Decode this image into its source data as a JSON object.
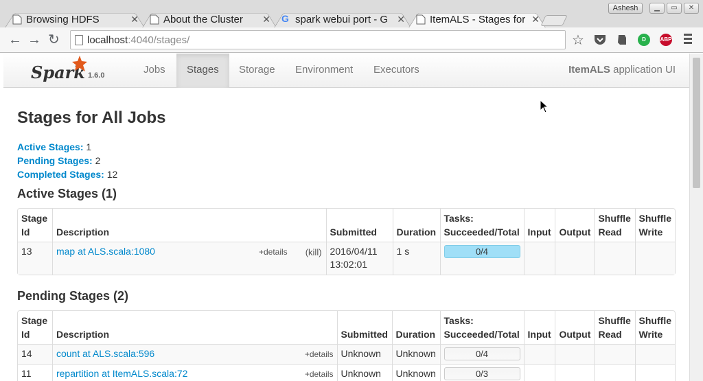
{
  "browser": {
    "tabs": [
      {
        "title": "Browsing HDFS",
        "icon": "page-icon",
        "active": false
      },
      {
        "title": "About the Cluster",
        "icon": "page-icon",
        "active": false
      },
      {
        "title": "spark webui port - G",
        "icon": "google-icon",
        "active": false
      },
      {
        "title": "ItemALS - Stages for",
        "icon": "page-icon",
        "active": true
      }
    ],
    "user": "Ashesh",
    "url_host": "localhost",
    "url_path": ":4040/stages/",
    "extensions": [
      {
        "name": "pocket-icon",
        "label": ""
      },
      {
        "name": "evernote-icon",
        "label": ""
      },
      {
        "name": "adblock-icon",
        "label": "ABP",
        "color": "#c70d2c"
      },
      {
        "name": "green-ext-icon",
        "label": "D",
        "color": "#28b14c"
      }
    ]
  },
  "spark": {
    "brand": "Spark",
    "version": "1.6.0",
    "nav": [
      "Jobs",
      "Stages",
      "Storage",
      "Environment",
      "Executors"
    ],
    "active_nav": "Stages",
    "app_name_bold": "ItemALS",
    "app_name_rest": " application UI"
  },
  "page": {
    "title": "Stages for All Jobs",
    "summary": {
      "active_label": "Active Stages:",
      "active_count": "1",
      "pending_label": "Pending Stages:",
      "pending_count": "2",
      "completed_label": "Completed Stages:",
      "completed_count": "12"
    },
    "active_heading": "Active Stages (1)",
    "pending_heading": "Pending Stages (2)"
  },
  "table_headers": {
    "stage_id_1": "Stage",
    "stage_id_2": "Id",
    "description": "Description",
    "submitted": "Submitted",
    "duration": "Duration",
    "tasks_1": "Tasks:",
    "tasks_2": "Succeeded/Total",
    "input": "Input",
    "output": "Output",
    "shuffle_read_1": "Shuffle",
    "shuffle_read_2": "Read",
    "shuffle_write_1": "Shuffle",
    "shuffle_write_2": "Write"
  },
  "active_stages": [
    {
      "id": "13",
      "description": "map at ALS.scala:1080",
      "details": "+details",
      "kill": "(kill)",
      "submitted_1": "2016/04/11",
      "submitted_2": "13:02:01",
      "duration": "1 s",
      "tasks": "0/4",
      "progress_fraction": 1.0
    }
  ],
  "pending_stages": [
    {
      "id": "14",
      "description": "count at ALS.scala:596",
      "details": "+details",
      "submitted": "Unknown",
      "duration": "Unknown",
      "tasks": "0/4",
      "progress_fraction": 0.0
    },
    {
      "id": "11",
      "description": "repartition at ItemALS.scala:72",
      "details": "+details",
      "submitted": "Unknown",
      "duration": "Unknown",
      "tasks": "0/3",
      "progress_fraction": 0.0
    }
  ]
}
